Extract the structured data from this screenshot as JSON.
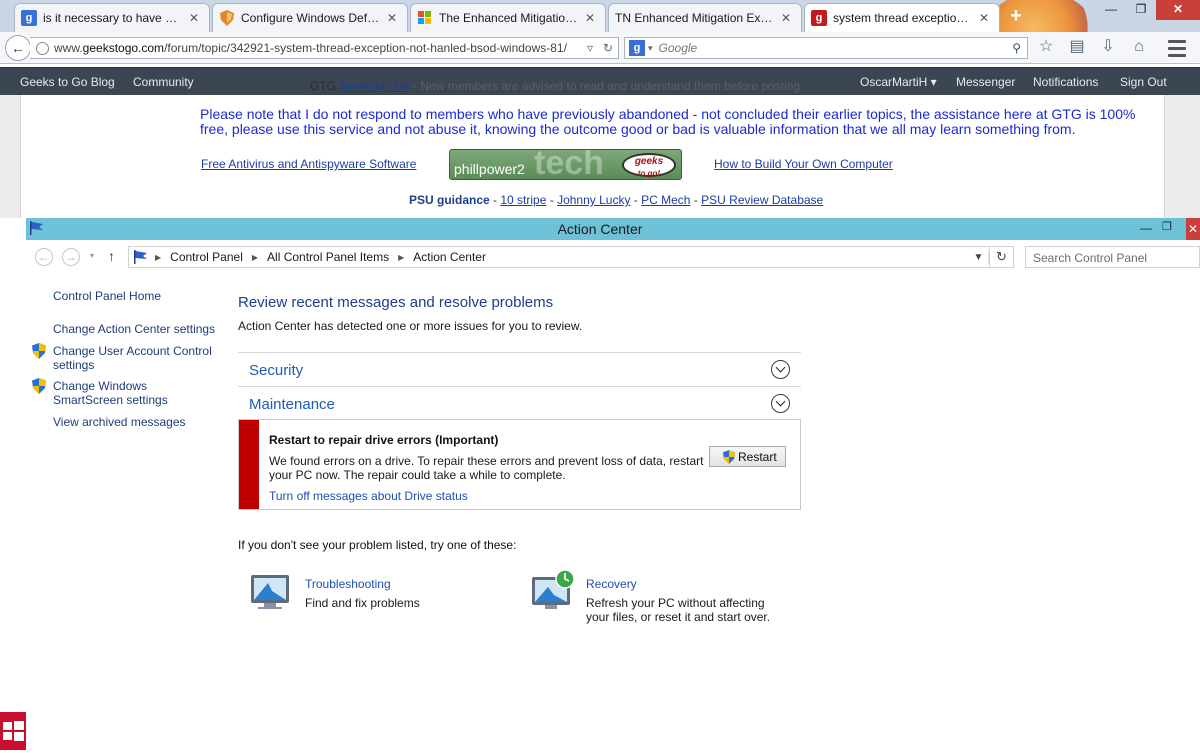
{
  "browser": {
    "tabs": [
      {
        "title": "is it necessary to have antiv...",
        "icon": "google-icon",
        "color": "#3b6fd8",
        "glyph": "g"
      },
      {
        "title": "Configure Windows Defen...",
        "icon": "shield-favicon-icon",
        "color": "#e0892a",
        "glyph": ""
      },
      {
        "title": "The Enhanced Mitigation E...",
        "icon": "windows-favicon-icon",
        "color": "#1f6fd6",
        "glyph": ""
      },
      {
        "title": "TN  Enhanced Mitigation Exper...",
        "icon": "",
        "color": "",
        "glyph": ""
      },
      {
        "title": "system thread exception n...",
        "icon": "geekstogo-favicon-icon",
        "color": "#c21a1a",
        "glyph": "g"
      }
    ],
    "new_tab": "+",
    "url_plain": "www.",
    "url_domain": "geekstogo.com",
    "url_path": "/forum/topic/342921-system-thread-exception-not-hanled-bsod-windows-81/",
    "search_placeholder": "Google",
    "window_minimize": "—",
    "window_restore": "❐",
    "window_close": "✕"
  },
  "site": {
    "nav_left": [
      "Geeks to Go Blog",
      "Community"
    ],
    "nav_right": [
      "OscarMartiH ▾",
      "Messenger",
      "Notifications",
      "Sign Out"
    ],
    "gtg_prefix": "GTG",
    "terms_link": "Terms of Use",
    "gtg_note": " - New members are advised to read and understand them before posting"
  },
  "page": {
    "notice": "Please note that I do not respond to members who have previously abandoned - not concluded their earlier topics, the assistance here at GTG is 100% free, please use this service and not abuse it, knowing the outcome good or bad is valuable information that we all may learn something from.",
    "sig_left": "Free Antivirus and Antispyware Software",
    "sig_right": "How to Build Your Own Computer",
    "banner_user": "phillpower2",
    "banner_tech": "tech",
    "banner_geeks": "geeks",
    "banner_togo": "to go!",
    "psu_label": "PSU guidance",
    "psu_links": [
      "10 stripe",
      "Johnny Lucky",
      "PC Mech",
      "PSU Review Database"
    ],
    "psu_sep": " - "
  },
  "action_center": {
    "window_title": "Action Center",
    "window_minimize": "—",
    "window_restore": "❐",
    "window_close": "✕",
    "breadcrumbs": [
      "Control Panel",
      "All Control Panel Items",
      "Action Center"
    ],
    "search_placeholder": "Search Control Panel",
    "left_nav": {
      "home": "Control Panel Home",
      "settings": "Change Action Center settings",
      "uac": "Change User Account Control settings",
      "smartscreen": "Change Windows SmartScreen settings",
      "archived": "View archived messages"
    },
    "heading": "Review recent messages and resolve problems",
    "subheading": "Action Center has detected one or more issues for you to review.",
    "sections": [
      "Security",
      "Maintenance"
    ],
    "message": {
      "title": "Restart to repair drive errors  (Important)",
      "body": "We found errors on a drive. To repair these errors and prevent loss of data, restart your PC now. The repair could take a while to complete.",
      "link": "Turn off messages about Drive status",
      "button": "Restart",
      "severity_color": "#c00000"
    },
    "try_line": "If you don't see your problem listed, try one of these:",
    "tools": [
      {
        "title": "Troubleshooting",
        "desc": "Find and fix problems"
      },
      {
        "title": "Recovery",
        "desc": "Refresh your PC without affecting your files, or reset it and start over."
      }
    ]
  }
}
